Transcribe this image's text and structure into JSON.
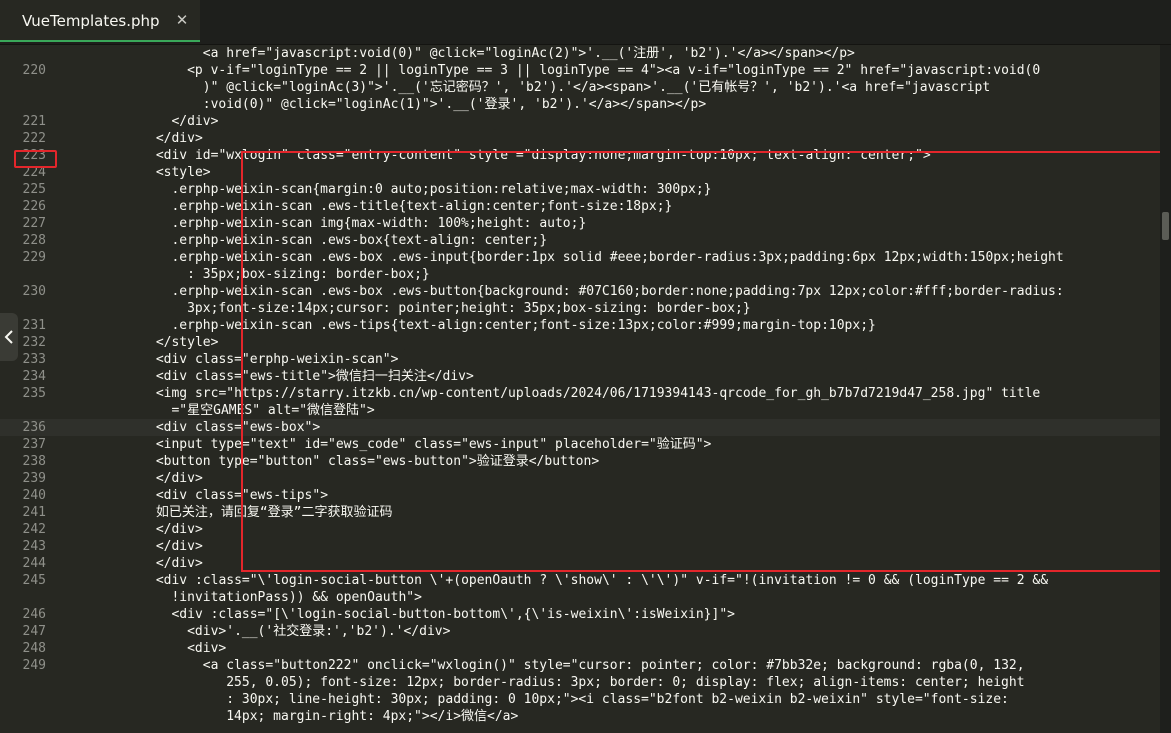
{
  "tab": {
    "title": "VueTemplates.php",
    "close_glyph": "✕"
  },
  "accent_colors": {
    "highlight_box": "#e3262b",
    "active_tab_underline": "#3aa85a"
  },
  "lines": [
    {
      "num": "",
      "indent": 18,
      "text": "<a href=\"javascript:void(0)\" @click=\"loginAc(2)\">'.__('注册', 'b2').'</a></span></p>"
    },
    {
      "num": "220",
      "indent": 16,
      "text": "<p v-if=\"loginType == 2 || loginType == 3 || loginType == 4\"><a v-if=\"loginType == 2\" href=\"javascript:void(0"
    },
    {
      "num": "",
      "indent": 18,
      "text": ")\" @click=\"loginAc(3)\">'.__('忘记密码？', 'b2').'</a><span>'.__('已有帐号？', 'b2').'<a href=\"javascript"
    },
    {
      "num": "",
      "indent": 18,
      "text": ":void(0)\" @click=\"loginAc(1)\">'.__('登录', 'b2').'</a></span></p>"
    },
    {
      "num": "221",
      "indent": 14,
      "text": "</div>"
    },
    {
      "num": "222",
      "indent": 12,
      "text": "</div>"
    },
    {
      "num": "223",
      "indent": 12,
      "text": "<div id=\"wxlogin\" class=\"entry-content\" style =\"display:none;margin-top:10px; text-align: center;\">"
    },
    {
      "num": "224",
      "indent": 12,
      "text": "<style>"
    },
    {
      "num": "225",
      "indent": 14,
      "text": ".erphp-weixin-scan{margin:0 auto;position:relative;max-width: 300px;}"
    },
    {
      "num": "226",
      "indent": 14,
      "text": ".erphp-weixin-scan .ews-title{text-align:center;font-size:18px;}"
    },
    {
      "num": "227",
      "indent": 14,
      "text": ".erphp-weixin-scan img{max-width: 100%;height: auto;}"
    },
    {
      "num": "228",
      "indent": 14,
      "text": ".erphp-weixin-scan .ews-box{text-align: center;}"
    },
    {
      "num": "229",
      "indent": 14,
      "text": ".erphp-weixin-scan .ews-box .ews-input{border:1px solid #eee;border-radius:3px;padding:6px 12px;width:150px;height"
    },
    {
      "num": "",
      "indent": 16,
      "text": ": 35px;box-sizing: border-box;}"
    },
    {
      "num": "230",
      "indent": 14,
      "text": ".erphp-weixin-scan .ews-box .ews-button{background: #07C160;border:none;padding:7px 12px;color:#fff;border-radius:"
    },
    {
      "num": "",
      "indent": 16,
      "text": "3px;font-size:14px;cursor: pointer;height: 35px;box-sizing: border-box;}"
    },
    {
      "num": "231",
      "indent": 14,
      "text": ".erphp-weixin-scan .ews-tips{text-align:center;font-size:13px;color:#999;margin-top:10px;}"
    },
    {
      "num": "232",
      "indent": 12,
      "text": "</style>"
    },
    {
      "num": "233",
      "indent": 12,
      "text": "<div class=\"erphp-weixin-scan\">"
    },
    {
      "num": "234",
      "indent": 12,
      "text": "<div class=\"ews-title\">微信扫一扫关注</div>"
    },
    {
      "num": "235",
      "indent": 12,
      "text": "<img src=\"https://starry.itzkb.cn/wp-content/uploads/2024/06/1719394143-qrcode_for_gh_b7b7d7219d47_258.jpg\" title"
    },
    {
      "num": "",
      "indent": 14,
      "text": "=\"星空GAMES\" alt=\"微信登陆\">"
    },
    {
      "num": "236",
      "indent": 12,
      "text": "<div class=\"ews-box\">",
      "current": true
    },
    {
      "num": "237",
      "indent": 12,
      "text": "<input type=\"text\" id=\"ews_code\" class=\"ews-input\" placeholder=\"验证码\">"
    },
    {
      "num": "238",
      "indent": 12,
      "text": "<button type=\"button\" class=\"ews-button\">验证登录</button>"
    },
    {
      "num": "239",
      "indent": 12,
      "text": "</div>"
    },
    {
      "num": "240",
      "indent": 12,
      "text": "<div class=\"ews-tips\">"
    },
    {
      "num": "241",
      "indent": 12,
      "text": "如已关注，请回复“登录”二字获取验证码"
    },
    {
      "num": "242",
      "indent": 12,
      "text": "</div>"
    },
    {
      "num": "243",
      "indent": 12,
      "text": "</div>"
    },
    {
      "num": "244",
      "indent": 12,
      "text": "</div>"
    },
    {
      "num": "245",
      "indent": 12,
      "text": "<div :class=\"\\'login-social-button \\'+(openOauth ? \\'show\\' : \\'\\')\" v-if=\"!(invitation != 0 && (loginType == 2 &&"
    },
    {
      "num": "",
      "indent": 14,
      "text": "!invitationPass)) && openOauth\">"
    },
    {
      "num": "246",
      "indent": 14,
      "text": "<div :class=\"[\\'login-social-button-bottom\\',{\\'is-weixin\\':isWeixin}]\">"
    },
    {
      "num": "247",
      "indent": 16,
      "text": "<div>'.__('社交登录:','b2').'</div>"
    },
    {
      "num": "248",
      "indent": 16,
      "text": "<div>"
    },
    {
      "num": "249",
      "indent": 18,
      "text": "<a class=\"button222\" onclick=\"wxlogin()\" style=\"cursor: pointer; color: #7bb32e; background: rgba(0, 132,"
    },
    {
      "num": "",
      "indent": 21,
      "text": "255, 0.05); font-size: 12px; border-radius: 3px; border: 0; display: flex; align-items: center; height"
    },
    {
      "num": "",
      "indent": 21,
      "text": ": 30px; line-height: 30px; padding: 0 10px;\"><i class=\"b2font b2-weixin b2-weixin\" style=\"font-size:"
    },
    {
      "num": "",
      "indent": 21,
      "text": "14px; margin-right: 4px;\"></i>微信</a>"
    }
  ]
}
